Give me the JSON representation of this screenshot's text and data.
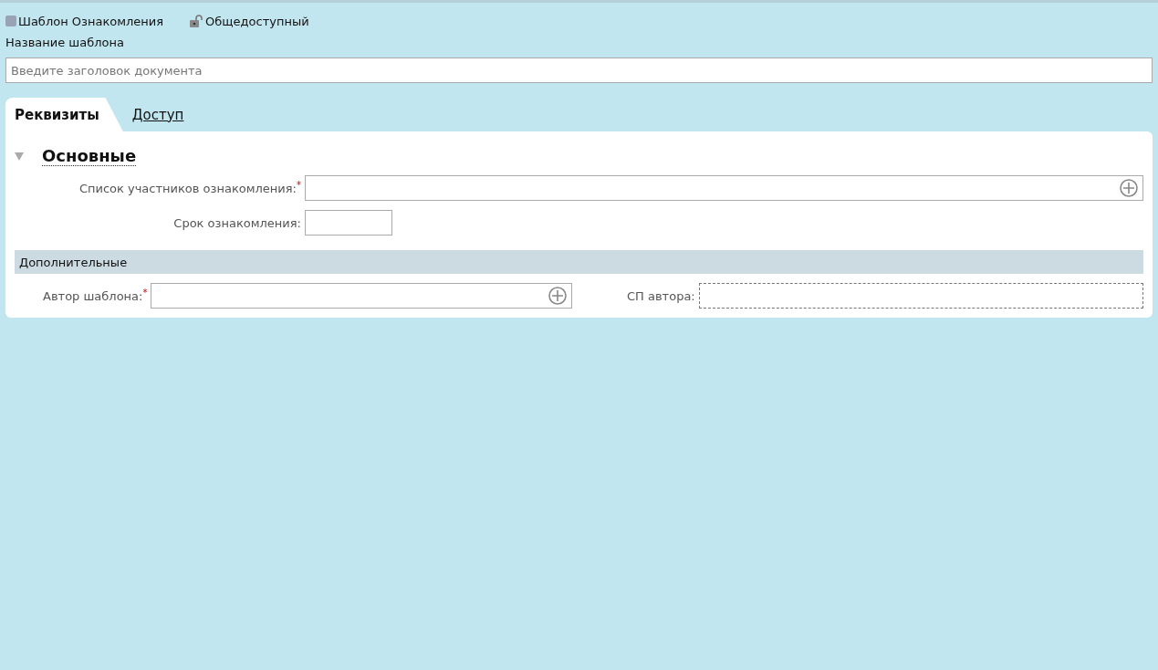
{
  "header": {
    "template_type": "Шаблон Ознакомления",
    "access": "Общедоступный"
  },
  "name_label": "Название шаблона",
  "name_field": {
    "placeholder": "Введите заголовок документа"
  },
  "tabs": [
    {
      "label": "Реквизиты",
      "selected": true
    },
    {
      "label": "Доступ",
      "selected": false
    }
  ],
  "main_section": {
    "title": "Основные",
    "expanded": true,
    "fields": [
      {
        "label": "Список участников ознакомления:",
        "required_mark": "*",
        "kind": "picker"
      },
      {
        "label": "Срок ознакомления:",
        "kind": "short"
      }
    ]
  },
  "extra_section": {
    "title": "Дополнительные",
    "fields": [
      {
        "label": "Автор шаблона:",
        "required_mark": "*",
        "kind": "picker"
      },
      {
        "label": "СП автора:",
        "kind": "readonly"
      }
    ]
  }
}
